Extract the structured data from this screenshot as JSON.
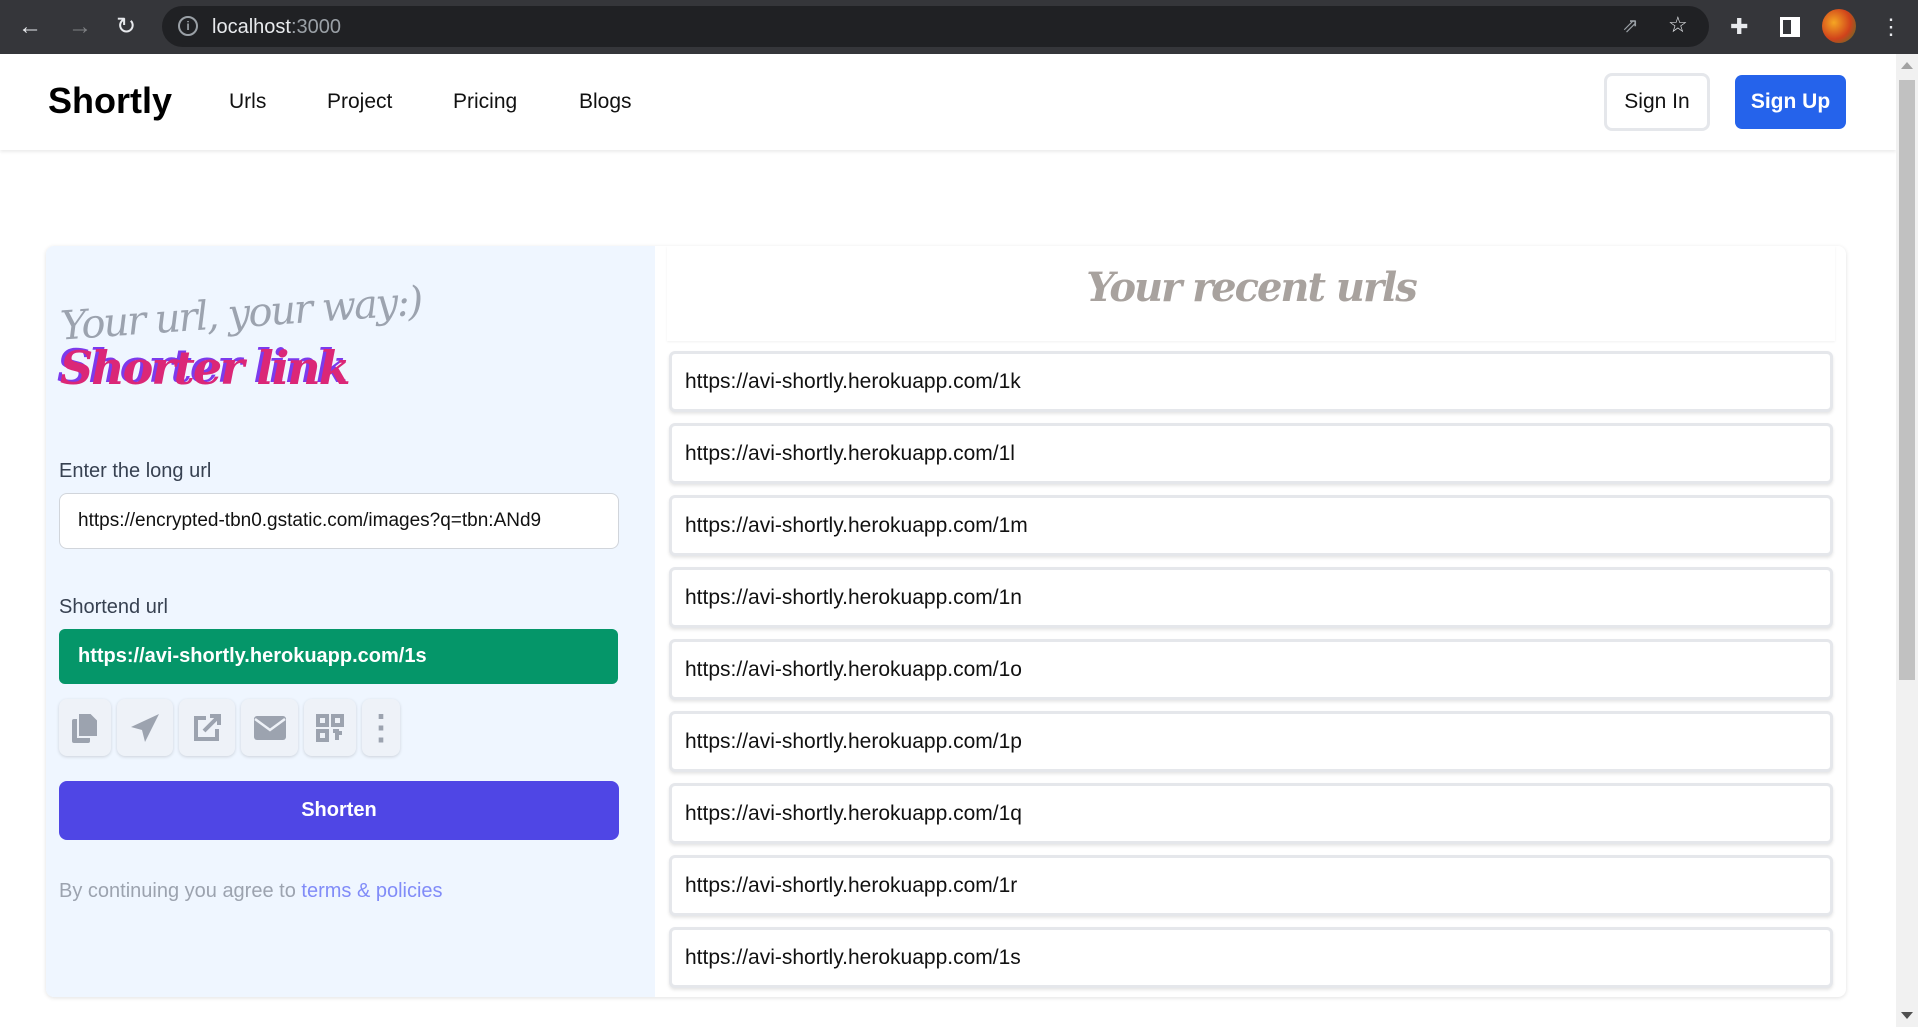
{
  "browser": {
    "url_host": "localhost",
    "url_port": ":3000"
  },
  "nav": {
    "logo": "Shortly",
    "links": [
      "Urls",
      "Project",
      "Pricing",
      "Blogs"
    ],
    "sign_in": "Sign In",
    "sign_up": "Sign Up"
  },
  "left": {
    "tagline": "Your url, your way:)",
    "headline": "Shorter link",
    "long_url_label": "Enter the long url",
    "long_url_value": "https://encrypted-tbn0.gstatic.com/images?q=tbn:ANd9",
    "short_url_label": "Shortend url",
    "short_url_value": "https://avi-shortly.herokuapp.com/1s",
    "actions": [
      "copy-icon",
      "send-icon",
      "open-external-icon",
      "mail-icon",
      "qr-code-icon",
      "more-vertical-icon"
    ],
    "shorten_label": "Shorten",
    "terms_prefix": "By continuing you agree to ",
    "terms_link": "terms & policies"
  },
  "right": {
    "title": "Your recent urls",
    "urls": [
      "https://avi-shortly.herokuapp.com/1k",
      "https://avi-shortly.herokuapp.com/1l",
      "https://avi-shortly.herokuapp.com/1m",
      "https://avi-shortly.herokuapp.com/1n",
      "https://avi-shortly.herokuapp.com/1o",
      "https://avi-shortly.herokuapp.com/1p",
      "https://avi-shortly.herokuapp.com/1q",
      "https://avi-shortly.herokuapp.com/1r",
      "https://avi-shortly.herokuapp.com/1s"
    ]
  },
  "colors": {
    "brand_blue": "#2563eb",
    "shorten": "#4f46e5",
    "short_url_bg": "#059669",
    "panel_bg": "#eff6ff"
  }
}
